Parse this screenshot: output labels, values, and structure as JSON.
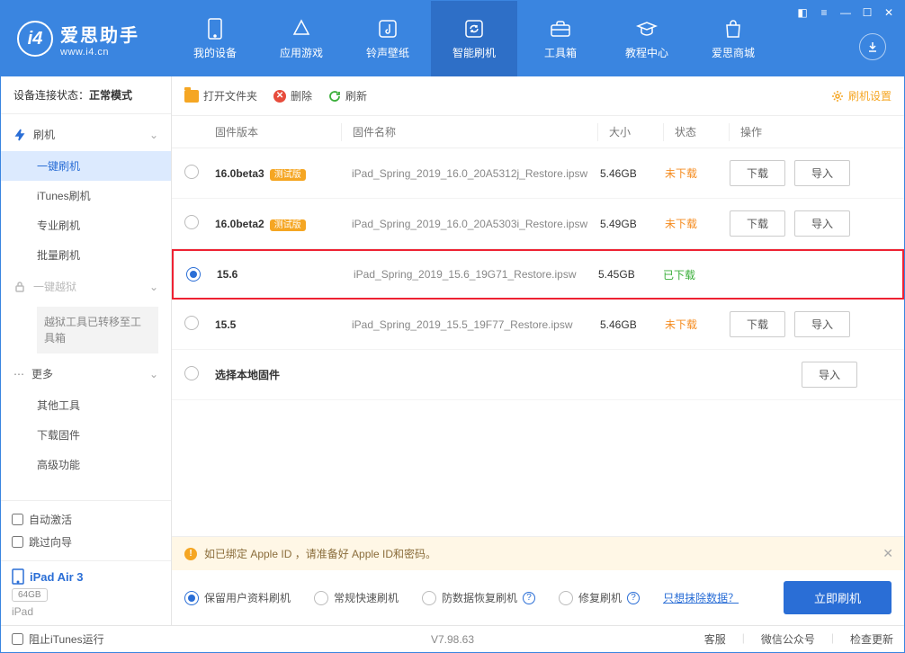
{
  "app": {
    "name": "爱思助手",
    "url": "www.i4.cn"
  },
  "nav": [
    {
      "label": "我的设备"
    },
    {
      "label": "应用游戏"
    },
    {
      "label": "铃声壁纸"
    },
    {
      "label": "智能刷机"
    },
    {
      "label": "工具箱"
    },
    {
      "label": "教程中心"
    },
    {
      "label": "爱思商城"
    }
  ],
  "sidebar": {
    "conn_label": "设备连接状态：",
    "conn_value": "正常模式",
    "group_flash": "刷机",
    "items_flash": [
      "一键刷机",
      "iTunes刷机",
      "专业刷机",
      "批量刷机"
    ],
    "group_jail": "一键越狱",
    "jail_note": "越狱工具已转移至工具箱",
    "group_more": "更多",
    "items_more": [
      "其他工具",
      "下载固件",
      "高级功能"
    ],
    "auto_activate": "自动激活",
    "skip_guide": "跳过向导",
    "device_name": "iPad Air 3",
    "storage": "64GB",
    "device_type": "iPad"
  },
  "toolbar": {
    "open_folder": "打开文件夹",
    "delete": "删除",
    "refresh": "刷新",
    "settings": "刷机设置"
  },
  "columns": {
    "version": "固件版本",
    "name": "固件名称",
    "size": "大小",
    "status": "状态",
    "ops": "操作"
  },
  "rows": [
    {
      "ver": "16.0beta3",
      "beta": "测试版",
      "name": "iPad_Spring_2019_16.0_20A5312j_Restore.ipsw",
      "size": "5.46GB",
      "status": "未下载",
      "status_cls": "not",
      "selected": false,
      "ops": true
    },
    {
      "ver": "16.0beta2",
      "beta": "测试版",
      "name": "iPad_Spring_2019_16.0_20A5303i_Restore.ipsw",
      "size": "5.49GB",
      "status": "未下载",
      "status_cls": "not",
      "selected": false,
      "ops": true
    },
    {
      "ver": "15.6",
      "beta": "",
      "name": "iPad_Spring_2019_15.6_19G71_Restore.ipsw",
      "size": "5.45GB",
      "status": "已下载",
      "status_cls": "done",
      "selected": true,
      "ops": false,
      "highlight": true
    },
    {
      "ver": "15.5",
      "beta": "",
      "name": "iPad_Spring_2019_15.5_19F77_Restore.ipsw",
      "size": "5.46GB",
      "status": "未下载",
      "status_cls": "not",
      "selected": false,
      "ops": true
    },
    {
      "ver": "选择本地固件",
      "beta": "",
      "name": "",
      "size": "",
      "status": "",
      "status_cls": "",
      "selected": false,
      "ops_import_only": true
    }
  ],
  "ops": {
    "download": "下载",
    "import": "导入"
  },
  "notice": "如已绑定 Apple ID ，请准备好 Apple ID和密码。",
  "flash_opts": {
    "keep": "保留用户资料刷机",
    "normal": "常规快速刷机",
    "recover": "防数据恢复刷机",
    "repair": "修复刷机",
    "erase_link": "只想抹除数据？",
    "go": "立即刷机"
  },
  "footer": {
    "block_itunes": "阻止iTunes运行",
    "version": "V7.98.63",
    "support": "客服",
    "wechat": "微信公众号",
    "update": "检查更新"
  }
}
